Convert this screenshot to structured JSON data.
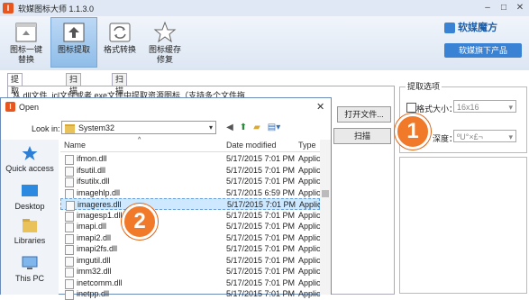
{
  "app": {
    "title": "软媒图标大师 1.1.3.0",
    "icon_letter": "I"
  },
  "toolbar": {
    "items": [
      {
        "label1": "图标一键",
        "label2": "替换"
      },
      {
        "label1": "图标提取",
        "label2": ""
      },
      {
        "label1": "格式转换",
        "label2": ""
      },
      {
        "label1": "图标缓存",
        "label2": "修复"
      }
    ],
    "brand_text": "软媒魔方",
    "brand_button": "软媒旗下产品"
  },
  "tabs": [
    "提取文件图标",
    "扫描文件夹",
    "扫描进程"
  ],
  "main": {
    "source_text": "从.dll文件 .icl文件或者.exe文件中提取资源图标（支持多个文件拖",
    "open_button": "打开文件...",
    "scan_button": "扫描"
  },
  "options": {
    "title": "提取选项",
    "size_label": "格式大小：",
    "size_value": "16x16",
    "depth_label": "深度：",
    "depth_value": "ºU°×£¬"
  },
  "dialog": {
    "title": "Open",
    "icon_letter": "I",
    "close": "✕",
    "lookin_label": "Look in:",
    "lookin_value": "System32",
    "places": [
      "Quick access",
      "Desktop",
      "Libraries",
      "This PC"
    ],
    "columns": {
      "name": "Name",
      "date": "Date modified",
      "type": "Type"
    },
    "files": [
      {
        "name": "ifmon.dll",
        "date": "5/17/2015 7:01 PM",
        "type": "Applic"
      },
      {
        "name": "ifsutil.dll",
        "date": "5/17/2015 7:01 PM",
        "type": "Applic"
      },
      {
        "name": "ifsutilx.dll",
        "date": "5/17/2015 7:01 PM",
        "type": "Applic"
      },
      {
        "name": "imagehlp.dll",
        "date": "5/17/2015 6:59 PM",
        "type": "Applic"
      },
      {
        "name": "imageres.dll",
        "date": "5/17/2015 7:01 PM",
        "type": "Applic"
      },
      {
        "name": "imagesp1.dll",
        "date": "5/17/2015 7:01 PM",
        "type": "Applic"
      },
      {
        "name": "imapi.dll",
        "date": "5/17/2015 7:01 PM",
        "type": "Applic"
      },
      {
        "name": "imapi2.dll",
        "date": "5/17/2015 7:01 PM",
        "type": "Applic"
      },
      {
        "name": "imapi2fs.dll",
        "date": "5/17/2015 7:01 PM",
        "type": "Applic"
      },
      {
        "name": "imgutil.dll",
        "date": "5/17/2015 7:01 PM",
        "type": "Applic"
      },
      {
        "name": "imm32.dll",
        "date": "5/17/2015 7:01 PM",
        "type": "Applic"
      },
      {
        "name": "inetcomm.dll",
        "date": "5/17/2015 7:01 PM",
        "type": "Applic"
      },
      {
        "name": "inetpp.dll",
        "date": "5/17/2015 7:01 PM",
        "type": "Applic"
      }
    ]
  },
  "callouts": {
    "step1": "1",
    "step2": "2"
  },
  "colors": {
    "accent": "#f07a2a",
    "selection": "#cde8ff",
    "brand": "#3a83d4"
  }
}
